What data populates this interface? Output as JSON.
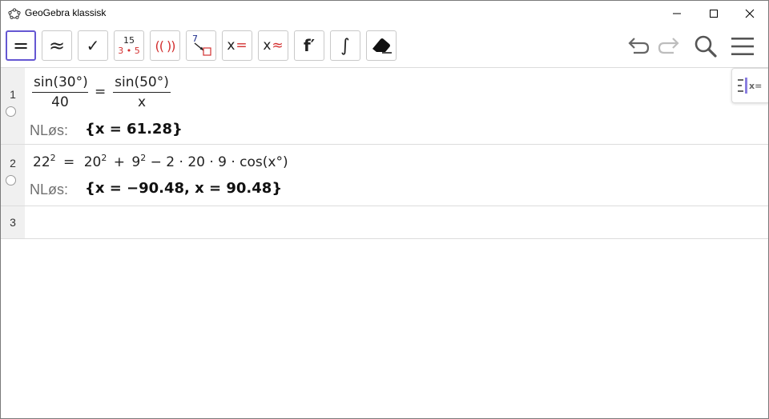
{
  "window": {
    "title": "GeoGebra klassisk"
  },
  "toolbar": {
    "tools": [
      {
        "name": "exact-evaluate",
        "label": "="
      },
      {
        "name": "numeric-evaluate",
        "label": "≈"
      },
      {
        "name": "keep-input",
        "label": "✓"
      },
      {
        "name": "factor",
        "label_top": "15",
        "label_bottom": "3 • 5"
      },
      {
        "name": "expand",
        "label": "(( ))"
      },
      {
        "name": "substitute",
        "label": "7"
      },
      {
        "name": "solve",
        "label_x": "x",
        "label_op": "="
      },
      {
        "name": "solve-numerically",
        "label_x": "x",
        "label_op": "≈"
      },
      {
        "name": "derivative",
        "label": "f′"
      },
      {
        "name": "integral",
        "label": "∫"
      },
      {
        "name": "delete",
        "label": ""
      }
    ]
  },
  "cas": {
    "rows": [
      {
        "number": "1",
        "input": {
          "lhs_num": "sin(30°)",
          "lhs_den": "40",
          "eq": "=",
          "rhs_num": "sin(50°)",
          "rhs_den": "x"
        },
        "output_label": "NLøs:",
        "output": "{x = 61.28}"
      },
      {
        "number": "2",
        "input": {
          "base_l": "22",
          "exp_l": "2",
          "eq": "=",
          "a": "20",
          "a_exp": "2",
          "plus": "+",
          "b": "9",
          "b_exp": "2",
          "rest": "− 2 · 20 · 9 · cos(x°)"
        },
        "output_label": "NLøs:",
        "output": "{x = −90.48, x = 90.48}"
      },
      {
        "number": "3",
        "input": {}
      }
    ]
  },
  "side_panel": {
    "label": "x="
  },
  "colors": {
    "accent": "#6557d2",
    "red": "#d32f2f",
    "gutter": "#f0f0f0"
  }
}
